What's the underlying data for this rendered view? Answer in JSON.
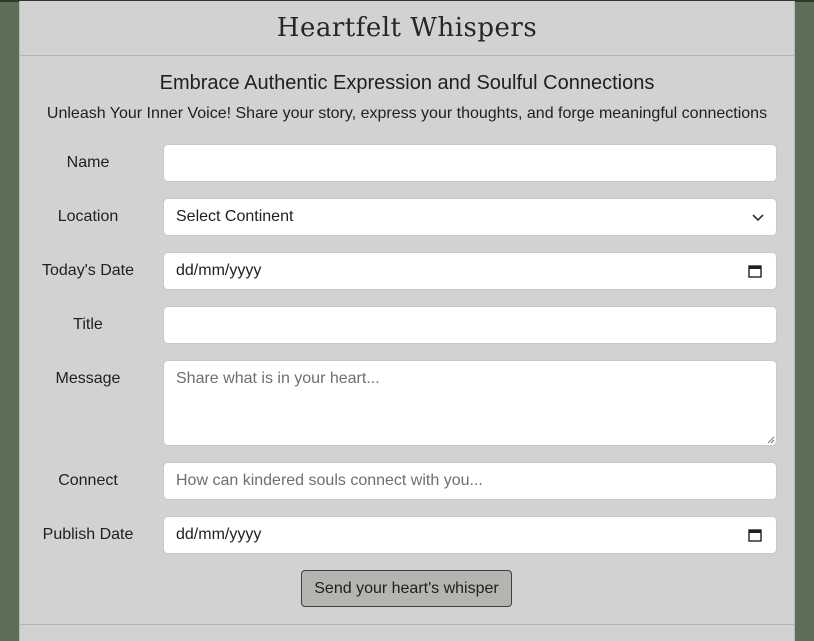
{
  "site": {
    "title": "Heartfelt Whispers",
    "subtitle": "Embrace Authentic Expression and Soulful Connections",
    "tagline": "Unleash Your Inner Voice! Share your story, express your thoughts, and forge meaningful connections"
  },
  "form": {
    "name": {
      "label": "Name",
      "value": ""
    },
    "location": {
      "label": "Location",
      "selected": "Select Continent"
    },
    "todays_date": {
      "label": "Today's Date",
      "value": "dd/mm/yyyy"
    },
    "title": {
      "label": "Title",
      "value": ""
    },
    "message": {
      "label": "Message",
      "placeholder": "Share what is in your heart..."
    },
    "connect": {
      "label": "Connect",
      "placeholder": "How can kindered souls connect with you..."
    },
    "publish_date": {
      "label": "Publish Date",
      "value": "dd/mm/yyyy"
    },
    "submit_label": "Send your heart's whisper"
  },
  "colors": {
    "background": "#5e6d58",
    "panel": "#d2d2d2",
    "button": "#b3b5ae"
  }
}
